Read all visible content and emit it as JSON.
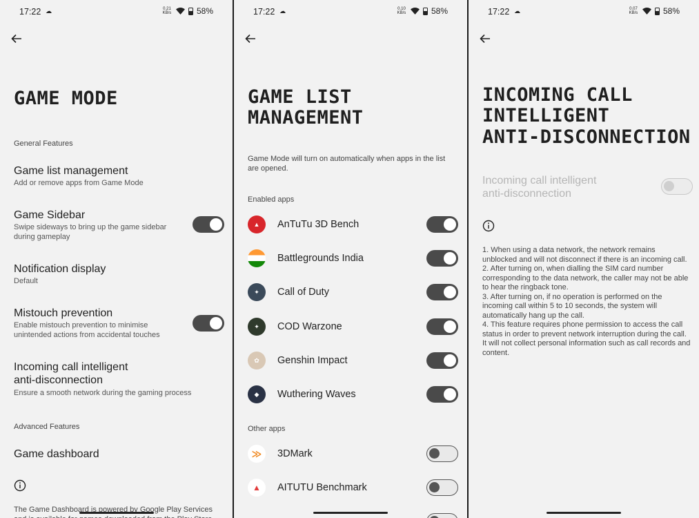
{
  "status": {
    "panel1": {
      "time": "17:22",
      "speed_value": "0.21",
      "speed_unit": "KB/s",
      "battery": "58%"
    },
    "panel2": {
      "time": "17:22",
      "speed_value": "0.10",
      "speed_unit": "KB/s",
      "battery": "58%"
    },
    "panel3": {
      "time": "17:22",
      "speed_value": "0.07",
      "speed_unit": "KB/s",
      "battery": "58%"
    }
  },
  "game_mode": {
    "title": "GAME MODE",
    "section_general": "General Features",
    "items": [
      {
        "title": "Game list management",
        "subtitle": "Add or remove apps from Game Mode"
      },
      {
        "title": "Game Sidebar",
        "subtitle": "Swipe sideways to bring up the game sidebar during gameplay",
        "toggle": "on"
      },
      {
        "title": "Notification display",
        "subtitle": "Default"
      },
      {
        "title": "Mistouch prevention",
        "subtitle": "Enable mistouch prevention to minimise unintended actions from accidental touches",
        "toggle": "on"
      },
      {
        "title": "Incoming call intelligent anti-disconnection",
        "subtitle": "Ensure a smooth network during the gaming process"
      }
    ],
    "section_advanced": "Advanced Features",
    "dashboard": "Game dashboard",
    "footer_text": "The Game Dashboard is powered by Google Play Services and is available for games downloaded from the Play Store."
  },
  "game_list": {
    "title_line1": "GAME LIST",
    "title_line2": "MANAGEMENT",
    "description": "Game Mode will turn on automatically when apps in the list are opened.",
    "section_enabled": "Enabled apps",
    "enabled_apps": [
      {
        "name": "AnTuTu 3D Bench",
        "color": "#d8262b"
      },
      {
        "name": "Battlegrounds India",
        "color": "#c98a3a"
      },
      {
        "name": "Call of Duty",
        "color": "#3b4a5a"
      },
      {
        "name": "COD Warzone",
        "color": "#2f3a2c"
      },
      {
        "name": "Genshin Impact",
        "color": "#d9c8b5"
      },
      {
        "name": "Wuthering Waves",
        "color": "#2a3245"
      }
    ],
    "section_other": "Other apps",
    "other_apps": [
      {
        "name": "3DMark",
        "color": "#f08a24"
      },
      {
        "name": "AITUTU Benchmark",
        "color": "#e23a3a"
      }
    ]
  },
  "anti_disconnect": {
    "title_line1": "INCOMING CALL",
    "title_line2": "INTELLIGENT",
    "title_line3": "ANTI-DISCONNECTION",
    "toggle_label": "Incoming call intelligent anti-disconnection",
    "notes": "1. When using a data network, the network remains unblocked and will not disconnect if there is an incoming call.\n2. After turning on, when dialling the SIM card number corresponding to the data network, the caller may not be able to hear the ringback tone.\n3. After turning on, if no operation is performed on the incoming call within 5 to 10 seconds, the system will automatically hang up the call.\n4. This feature requires phone permission to access the call status in order to prevent network interruption during the call. It will not collect personal information such as call records and content."
  },
  "icons": {
    "back": "arrow-left-icon",
    "info": "info-circle-icon",
    "wifi": "wifi-icon",
    "battery": "battery-icon",
    "cloud": "cloud-icon"
  }
}
